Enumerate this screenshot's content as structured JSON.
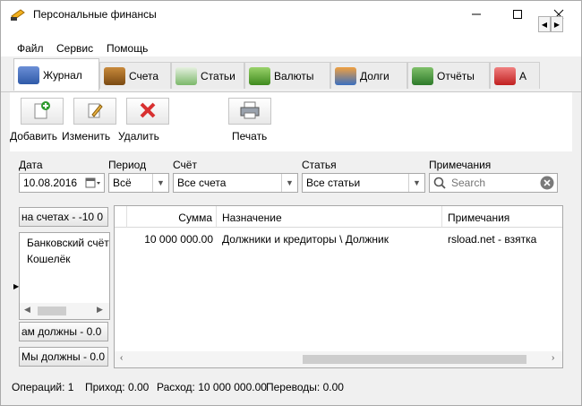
{
  "window": {
    "title": "Персональные финансы"
  },
  "menu": [
    "Файл",
    "Сервис",
    "Помощь"
  ],
  "tabs": [
    {
      "label": "Журнал",
      "icon": "journal-icon"
    },
    {
      "label": "Счета",
      "icon": "accounts-icon"
    },
    {
      "label": "Статьи",
      "icon": "articles-icon"
    },
    {
      "label": "Валюты",
      "icon": "currency-icon"
    },
    {
      "label": "Долги",
      "icon": "debts-icon"
    },
    {
      "label": "Отчёты",
      "icon": "reports-icon"
    },
    {
      "label": "А",
      "icon": "analytics-icon"
    }
  ],
  "toolbar": {
    "add_label": "Добавить",
    "edit_label": "Изменить",
    "delete_label": "Удалить",
    "print_label": "Печать"
  },
  "filter": {
    "date_label": "Дата",
    "date_value": "10.08.2016",
    "period_label": "Период",
    "period_value": "Всё",
    "account_label": "Счёт",
    "account_value": "Все счета",
    "article_label": "Статья",
    "article_value": "Все статьи",
    "notes_label": "Примечания",
    "search_placeholder": "Search"
  },
  "left_panel": {
    "on_accounts": "на счетах  -  -10 0",
    "accounts": [
      "Банковский счёт",
      "Кошелёк"
    ],
    "owed_to_us": "ам должны  -  0.0",
    "we_owe": "Мы должны  -  0.0"
  },
  "grid": {
    "columns": [
      "Сумма",
      "Назначение",
      "Примечания"
    ],
    "rows": [
      {
        "amount": "10 000 000.00",
        "purpose": "Должники и кредиторы \\ Должник",
        "note": "rsload.net - взятка"
      }
    ]
  },
  "status": {
    "operations": "Операций: 1",
    "income": "Приход: 0.00",
    "expense": "Расход: 10 000 000.00",
    "transfers": "Переводы: 0.00"
  }
}
